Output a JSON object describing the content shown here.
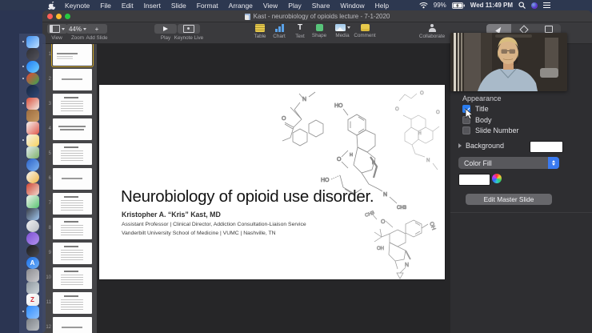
{
  "menu_bar": {
    "items": [
      "Keynote",
      "File",
      "Edit",
      "Insert",
      "Slide",
      "Format",
      "Arrange",
      "View",
      "Play",
      "Share",
      "Window",
      "Help"
    ],
    "status": {
      "battery_percent": "99%",
      "clock": "Wed 11:49 PM"
    }
  },
  "window": {
    "title": "Kast - neurobiology of opioids lecture - 7-1-2020"
  },
  "toolbar": {
    "view": {
      "label": "View"
    },
    "zoom": {
      "label": "Zoom",
      "value": "44%"
    },
    "add_slide": {
      "label": "Add Slide",
      "glyph": "+"
    },
    "play": {
      "label": "Play"
    },
    "keynote_live": {
      "label": "Keynote Live"
    },
    "insert": [
      {
        "label": "Table"
      },
      {
        "label": "Chart"
      },
      {
        "label": "Text",
        "glyph": "T"
      },
      {
        "label": "Shape"
      },
      {
        "label": "Media"
      },
      {
        "label": "Comment"
      }
    ],
    "collaborate": {
      "label": "Collaborate"
    },
    "right_tabs": [
      {
        "label": "Format",
        "selected": true
      },
      {
        "label": "Animate",
        "selected": false
      },
      {
        "label": "Document",
        "selected": false
      }
    ]
  },
  "dock": {
    "apps": [
      {
        "name": "finder",
        "c1": "#3b8df0",
        "c2": "#bfe0ff",
        "shape": "rsq",
        "running": true
      },
      {
        "name": "launchpad",
        "c1": "#2e2e33",
        "c2": "#55555e",
        "shape": "circle"
      },
      {
        "name": "safari",
        "c1": "#1f7cf5",
        "c2": "#6fd0ff",
        "shape": "circle",
        "running": true
      },
      {
        "name": "chrome",
        "c1": "#e94335",
        "c2": "#34a853",
        "shape": "circle",
        "running": true
      },
      {
        "name": "dark-blue-app",
        "c1": "#16253f",
        "c2": "#2f4a77",
        "shape": "circle"
      },
      {
        "name": "red-white-app",
        "c1": "#d94f3d",
        "c2": "#f3ece4",
        "shape": "rsq",
        "running": true
      },
      {
        "name": "books-app",
        "c1": "#9c6b3f",
        "c2": "#c79a63",
        "shape": "rsq"
      },
      {
        "name": "calendar",
        "c1": "#f5f3f0",
        "c2": "#e0574a",
        "shape": "rsq"
      },
      {
        "name": "notes",
        "c1": "#f3f2ec",
        "c2": "#f7d35e",
        "shape": "rsq",
        "running": true
      },
      {
        "name": "preview",
        "c1": "#dfe9ef",
        "c2": "#7fb269",
        "shape": "rsq"
      },
      {
        "name": "blue-doc-app",
        "c1": "#2b62c9",
        "c2": "#7fb4f2",
        "shape": "circle"
      },
      {
        "name": "photos",
        "c1": "#f5f5f3",
        "c2": "#f2b544",
        "shape": "circle"
      },
      {
        "name": "red-app",
        "c1": "#cf4534",
        "c2": "#f0d9cf",
        "shape": "rsq"
      },
      {
        "name": "numbers-chart",
        "c1": "#f2f2ef",
        "c2": "#58c470",
        "shape": "rsq"
      },
      {
        "name": "screen-display",
        "c1": "#3c3f47",
        "c2": "#9fc6ef",
        "shape": "rsq"
      },
      {
        "name": "music",
        "c1": "#efeff1",
        "c2": "#b8bcc4",
        "shape": "circle"
      },
      {
        "name": "podcasts",
        "c1": "#7d4fd3",
        "c2": "#b393ef",
        "shape": "circle"
      },
      {
        "name": "tv",
        "c1": "#1c1c1e",
        "c2": "#4a4a4f",
        "shape": "circle"
      },
      {
        "name": "app-store",
        "c1": "#1a6fe8",
        "c2": "#6fb0f7",
        "shape": "circle",
        "glyph": "A"
      },
      {
        "name": "camera-app",
        "c1": "#8d8d91",
        "c2": "#c9c9cd",
        "shape": "rsq"
      },
      {
        "name": "messages-gray",
        "c1": "#8e979e",
        "c2": "#cfd6db",
        "shape": "rsq"
      },
      {
        "name": "zotero",
        "c1": "#ffffff",
        "c2": "#e9e9e9",
        "shape": "rsq",
        "glyph": "Z"
      },
      {
        "name": "zoom",
        "c1": "#2d8cff",
        "c2": "#8ec2ff",
        "shape": "rsq",
        "running": true
      },
      {
        "name": "trash",
        "c1": "#7e8287",
        "c2": "#b9bdc2",
        "shape": "rsq"
      }
    ]
  },
  "navigator": {
    "slides": [
      {
        "n": "1",
        "selected": true,
        "pattern": "p-title"
      },
      {
        "n": "2",
        "selected": false,
        "pattern": "p-center1"
      },
      {
        "n": "3",
        "selected": false,
        "pattern": "p-bullets"
      },
      {
        "n": "4",
        "selected": false,
        "pattern": "p-center2"
      },
      {
        "n": "5",
        "selected": false,
        "pattern": "p-bullets"
      },
      {
        "n": "6",
        "selected": false,
        "pattern": "p-center1"
      },
      {
        "n": "7",
        "selected": false,
        "pattern": "p-bullets"
      },
      {
        "n": "8",
        "selected": false,
        "pattern": "p-bullets"
      },
      {
        "n": "9",
        "selected": false,
        "pattern": "p-bullets"
      },
      {
        "n": "10",
        "selected": false,
        "pattern": "p-bullets"
      },
      {
        "n": "11",
        "selected": false,
        "pattern": "p-bullets"
      },
      {
        "n": "12",
        "selected": false,
        "pattern": "p-center1"
      }
    ]
  },
  "slide": {
    "title": "Neurobiology of opioid use disorder.",
    "author": "Kristopher A. “Kris” Kast, MD",
    "affiliation1": "Assistant Professor | Clinical Director, Addiction Consultation-Liaison Service",
    "affiliation2": "Vanderbilt University School of Medicine | VUMC | Nashville, TN",
    "molecule": {
      "ho": "HO",
      "oh": "OH",
      "o": "O",
      "n": "N",
      "ch3": "CH3",
      "h": "H"
    }
  },
  "inspector": {
    "appearance": {
      "label": "Appearance",
      "items": [
        {
          "label": "Title",
          "checked": true
        },
        {
          "label": "Body",
          "checked": false
        },
        {
          "label": "Slide Number",
          "checked": false
        }
      ]
    },
    "background": {
      "label": "Background",
      "fill_type": "Color Fill"
    },
    "edit_master_label": "Edit Master Slide"
  },
  "colors": {
    "accent_blue": "#2a7cf0",
    "selection_gold": "#c9a227",
    "menubar": "#2d3850",
    "canvas": "#262628",
    "slide_bg": "#ffffff"
  }
}
